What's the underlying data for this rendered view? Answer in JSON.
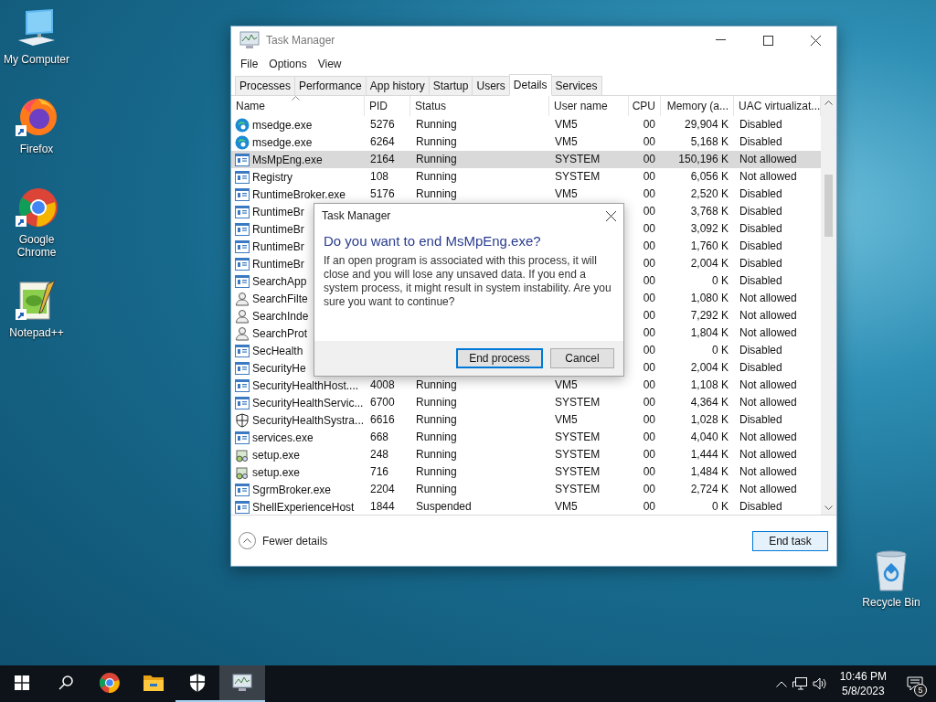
{
  "desktop": {
    "icons": [
      {
        "label": "My Computer",
        "kind": "computer"
      },
      {
        "label": "Firefox",
        "kind": "firefox"
      },
      {
        "label": "Google Chrome",
        "kind": "chrome"
      },
      {
        "label": "Notepad++",
        "kind": "notepad"
      },
      {
        "label": "Recycle Bin",
        "kind": "recycle"
      }
    ]
  },
  "window": {
    "title": "Task Manager",
    "menu": [
      "File",
      "Options",
      "View"
    ],
    "tabs": [
      {
        "label": "Processes",
        "selected": false
      },
      {
        "label": "Performance",
        "selected": false
      },
      {
        "label": "App history",
        "selected": false
      },
      {
        "label": "Startup",
        "selected": false
      },
      {
        "label": "Users",
        "selected": false
      },
      {
        "label": "Details",
        "selected": true
      },
      {
        "label": "Services",
        "selected": false
      }
    ],
    "table": {
      "columns": [
        {
          "label": "Name",
          "sorted": true
        },
        {
          "label": "PID",
          "sorted": false
        },
        {
          "label": "Status",
          "sorted": false
        },
        {
          "label": "User name",
          "sorted": false
        },
        {
          "label": "CPU",
          "sorted": false
        },
        {
          "label": "Memory (a...",
          "sorted": false
        },
        {
          "label": "UAC virtualizat...",
          "sorted": false
        }
      ],
      "rows": [
        {
          "kind": "edge",
          "name": "msedge.exe",
          "pid": "5276",
          "status": "Running",
          "user": "VM5",
          "cpu": "00",
          "memory": "29,904 K",
          "uac": "Disabled",
          "selected": false
        },
        {
          "kind": "edge",
          "name": "msedge.exe",
          "pid": "6264",
          "status": "Running",
          "user": "VM5",
          "cpu": "00",
          "memory": "5,168 K",
          "uac": "Disabled",
          "selected": false
        },
        {
          "kind": "app",
          "name": "MsMpEng.exe",
          "pid": "2164",
          "status": "Running",
          "user": "SYSTEM",
          "cpu": "00",
          "memory": "150,196 K",
          "uac": "Not allowed",
          "selected": true
        },
        {
          "kind": "app",
          "name": "Registry",
          "pid": "108",
          "status": "Running",
          "user": "SYSTEM",
          "cpu": "00",
          "memory": "6,056 K",
          "uac": "Not allowed",
          "selected": false
        },
        {
          "kind": "app",
          "name": "RuntimeBroker.exe",
          "pid": "5176",
          "status": "Running",
          "user": "VM5",
          "cpu": "00",
          "memory": "2,520 K",
          "uac": "Disabled",
          "selected": false
        },
        {
          "kind": "app",
          "name": "RuntimeBr",
          "cpu": "00",
          "memory": "3,768 K",
          "uac": "Disabled",
          "selected": false
        },
        {
          "kind": "app",
          "name": "RuntimeBr",
          "cpu": "00",
          "memory": "3,092 K",
          "uac": "Disabled",
          "selected": false
        },
        {
          "kind": "app",
          "name": "RuntimeBr",
          "cpu": "00",
          "memory": "1,760 K",
          "uac": "Disabled",
          "selected": false
        },
        {
          "kind": "app",
          "name": "RuntimeBr",
          "cpu": "00",
          "memory": "2,004 K",
          "uac": "Disabled",
          "selected": false
        },
        {
          "kind": "app",
          "name": "SearchApp",
          "cpu": "00",
          "memory": "0 K",
          "uac": "Disabled",
          "selected": false
        },
        {
          "kind": "user",
          "name": "SearchFilte",
          "cpu": "00",
          "memory": "1,080 K",
          "uac": "Not allowed",
          "selected": false
        },
        {
          "kind": "user",
          "name": "SearchInde",
          "cpu": "00",
          "memory": "7,292 K",
          "uac": "Not allowed",
          "selected": false
        },
        {
          "kind": "user",
          "name": "SearchProt",
          "cpu": "00",
          "memory": "1,804 K",
          "uac": "Not allowed",
          "selected": false
        },
        {
          "kind": "app",
          "name": "SecHealth",
          "cpu": "00",
          "memory": "0 K",
          "uac": "Disabled",
          "selected": false
        },
        {
          "kind": "app",
          "name": "SecurityHe",
          "cpu": "00",
          "memory": "2,004 K",
          "uac": "Disabled",
          "selected": false
        },
        {
          "kind": "app",
          "name": "SecurityHealthHost....",
          "pid": "4008",
          "status": "Running",
          "user": "VM5",
          "cpu": "00",
          "memory": "1,108 K",
          "uac": "Not allowed",
          "selected": false
        },
        {
          "kind": "app",
          "name": "SecurityHealthServic...",
          "pid": "6700",
          "status": "Running",
          "user": "SYSTEM",
          "cpu": "00",
          "memory": "4,364 K",
          "uac": "Not allowed",
          "selected": false
        },
        {
          "kind": "shield",
          "name": "SecurityHealthSystra...",
          "pid": "6616",
          "status": "Running",
          "user": "VM5",
          "cpu": "00",
          "memory": "1,028 K",
          "uac": "Disabled",
          "selected": false
        },
        {
          "kind": "app",
          "name": "services.exe",
          "pid": "668",
          "status": "Running",
          "user": "SYSTEM",
          "cpu": "00",
          "memory": "4,040 K",
          "uac": "Not allowed",
          "selected": false
        },
        {
          "kind": "installer",
          "name": "setup.exe",
          "pid": "248",
          "status": "Running",
          "user": "SYSTEM",
          "cpu": "00",
          "memory": "1,444 K",
          "uac": "Not allowed",
          "selected": false
        },
        {
          "kind": "installer",
          "name": "setup.exe",
          "pid": "716",
          "status": "Running",
          "user": "SYSTEM",
          "cpu": "00",
          "memory": "1,484 K",
          "uac": "Not allowed",
          "selected": false
        },
        {
          "kind": "app",
          "name": "SgrmBroker.exe",
          "pid": "2204",
          "status": "Running",
          "user": "SYSTEM",
          "cpu": "00",
          "memory": "2,724 K",
          "uac": "Not allowed",
          "selected": false
        },
        {
          "kind": "app",
          "name": "ShellExperienceHost",
          "pid": "1844",
          "status": "Suspended",
          "user": "VM5",
          "cpu": "00",
          "memory": "0 K",
          "uac": "Disabled",
          "selected": false
        }
      ]
    },
    "footer": {
      "toggle": "Fewer details",
      "button": "End task"
    }
  },
  "dialog": {
    "title": "Task Manager",
    "heading": "Do you want to end MsMpEng.exe?",
    "message": "If an open program is associated with this process, it will close and you will lose any unsaved data. If you end a system process, it might result in system instability. Are you sure you want to continue?",
    "buttons": [
      {
        "label": "End process",
        "selected": true
      },
      {
        "label": "Cancel",
        "selected": false
      }
    ]
  },
  "taskbar": {
    "apps": [
      {
        "kind": "chrome",
        "running": false,
        "selected": false
      },
      {
        "kind": "folder",
        "running": false,
        "selected": false
      },
      {
        "kind": "shield",
        "running": true,
        "selected": false
      },
      {
        "kind": "taskmgr",
        "running": true,
        "selected": true
      }
    ],
    "time": "10:46 PM",
    "date": "5/8/2023",
    "notifications": "5"
  }
}
